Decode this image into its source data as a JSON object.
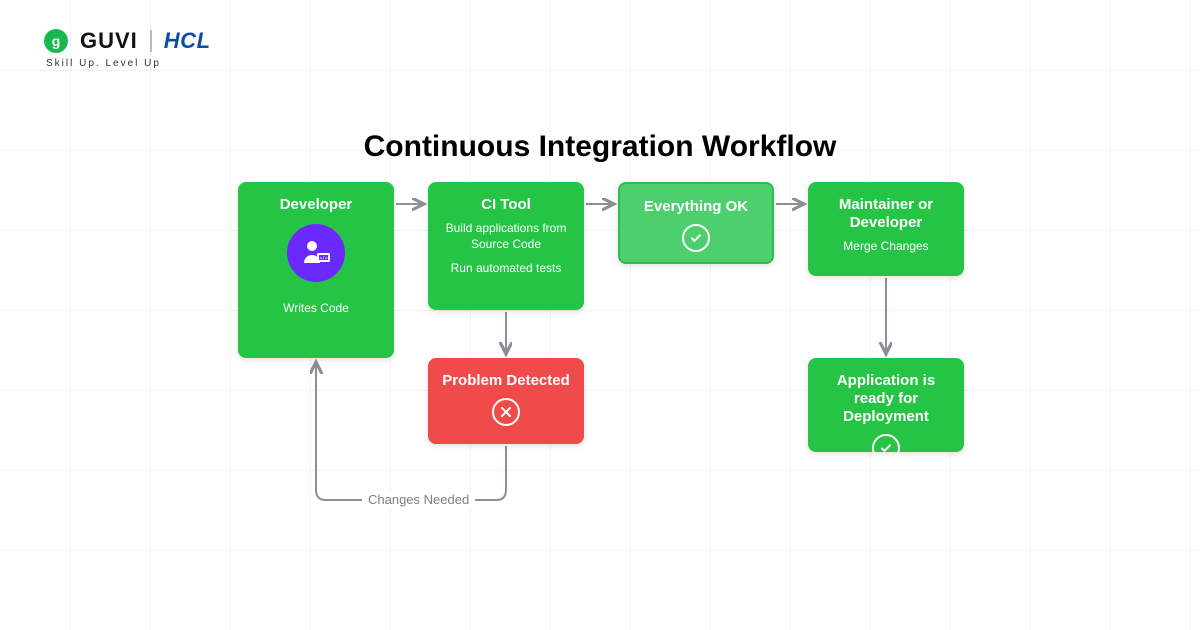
{
  "brand": {
    "guvi_glyph": "g",
    "guvi_name": "GUVI",
    "partner_name": "HCL",
    "tagline": "Skill Up. Level Up"
  },
  "title": "Continuous Integration Workflow",
  "nodes": {
    "developer": {
      "title": "Developer",
      "caption": "Writes Code"
    },
    "ci_tool": {
      "title": "CI Tool",
      "line1": "Build applications from Source Code",
      "line2": "Run automated tests"
    },
    "ok": {
      "title": "Everything OK"
    },
    "maintainer": {
      "title": "Maintainer or Developer",
      "caption": "Merge Changes"
    },
    "problem": {
      "title": "Problem Detected"
    },
    "deploy": {
      "title": "Application is ready for Deployment"
    }
  },
  "feedback_label": "Changes Needed"
}
